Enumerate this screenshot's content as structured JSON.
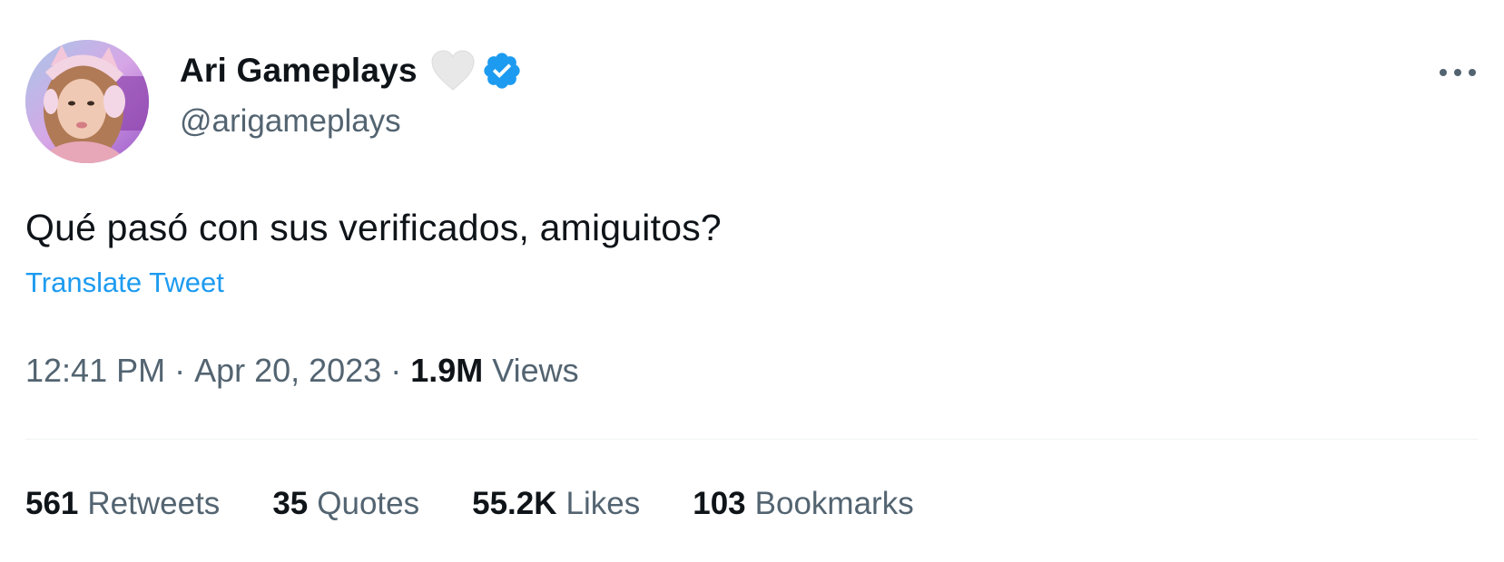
{
  "author": {
    "display_name": "Ari Gameplays",
    "handle": "@arigameplays",
    "heart_icon": "white-heart-icon",
    "verified_icon": "verified-badge-icon",
    "avatar_icon": "profile-avatar"
  },
  "menu": {
    "icon": "more-options-icon",
    "label": "···"
  },
  "tweet": {
    "text": "Qué pasó con sus verificados, amiguitos?",
    "translate_label": "Translate Tweet"
  },
  "meta": {
    "time": "12:41 PM",
    "separator": "·",
    "date": "Apr 20, 2023",
    "views_count": "1.9M",
    "views_label": "Views"
  },
  "stats": [
    {
      "count": "561",
      "label": "Retweets"
    },
    {
      "count": "35",
      "label": "Quotes"
    },
    {
      "count": "55.2K",
      "label": "Likes"
    },
    {
      "count": "103",
      "label": "Bookmarks"
    }
  ],
  "colors": {
    "text_primary": "#0f1419",
    "text_secondary": "#536471",
    "link": "#1d9bf0",
    "verified": "#1d9bf0",
    "divider": "#eff3f4",
    "heart": "#e8e8e8"
  }
}
